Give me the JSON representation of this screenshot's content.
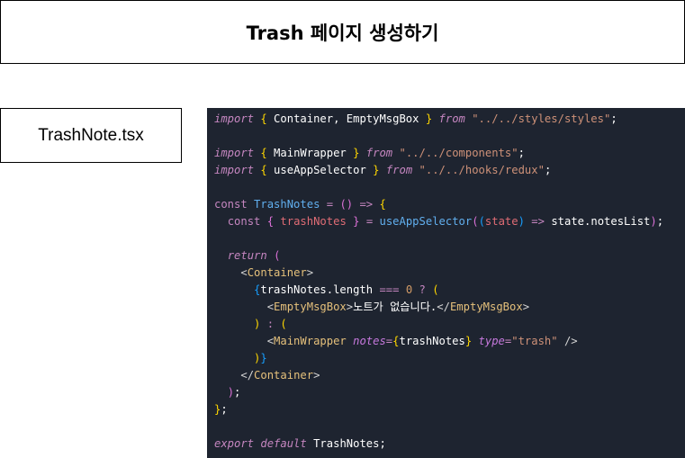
{
  "header": {
    "title": "Trash 페이지 생성하기"
  },
  "file": {
    "name": "TrashNote.tsx"
  },
  "code": {
    "import1_path": "\"../../styles/styles\"",
    "import2_path": "\"../../components\"",
    "import3_path": "\"../../hooks/redux\"",
    "empty_message": "노트가 없습니다.",
    "type_value": "\"trash\""
  },
  "colors": {
    "code_background": "#1e2430",
    "keyword": "#c586c0",
    "string": "#ce9178",
    "component": "#e5c07b",
    "function": "#61afef"
  }
}
